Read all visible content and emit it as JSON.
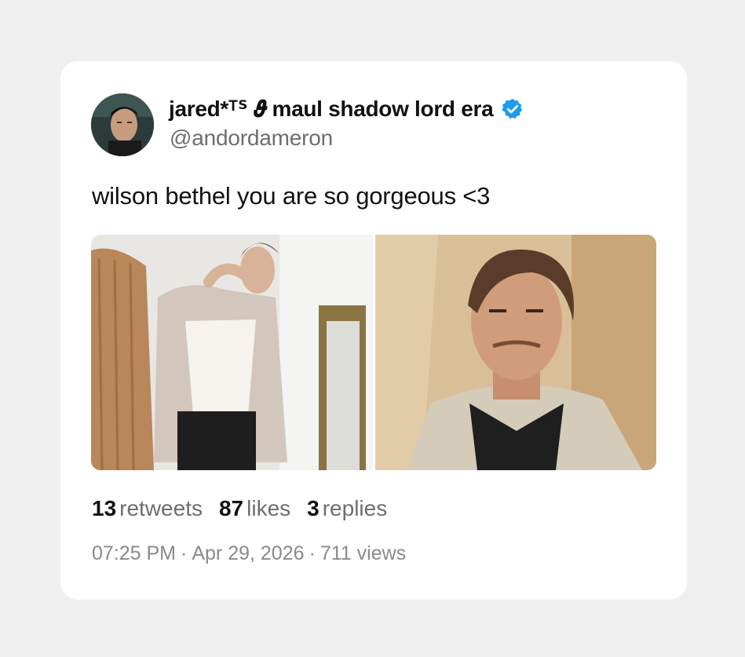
{
  "author": {
    "display_name": "jared*ᵀᔆ 𝝑 maul shadow lord era",
    "handle": "@andordameron",
    "verified_color": "#1d9bf0"
  },
  "tweet": {
    "text": "wilson bethel you are so gorgeous <3"
  },
  "media": {
    "photos": [
      {
        "alt": "man in white tank top holding shirt by mirror"
      },
      {
        "alt": "man in tan jacket smiling"
      }
    ]
  },
  "stats": {
    "retweets_count": "13",
    "retweets_label": "retweets",
    "likes_count": "87",
    "likes_label": "likes",
    "replies_count": "3",
    "replies_label": "replies"
  },
  "meta": {
    "time": "07:25 PM",
    "date": "Apr 29, 2026",
    "views": "711 views",
    "separator": "·"
  }
}
